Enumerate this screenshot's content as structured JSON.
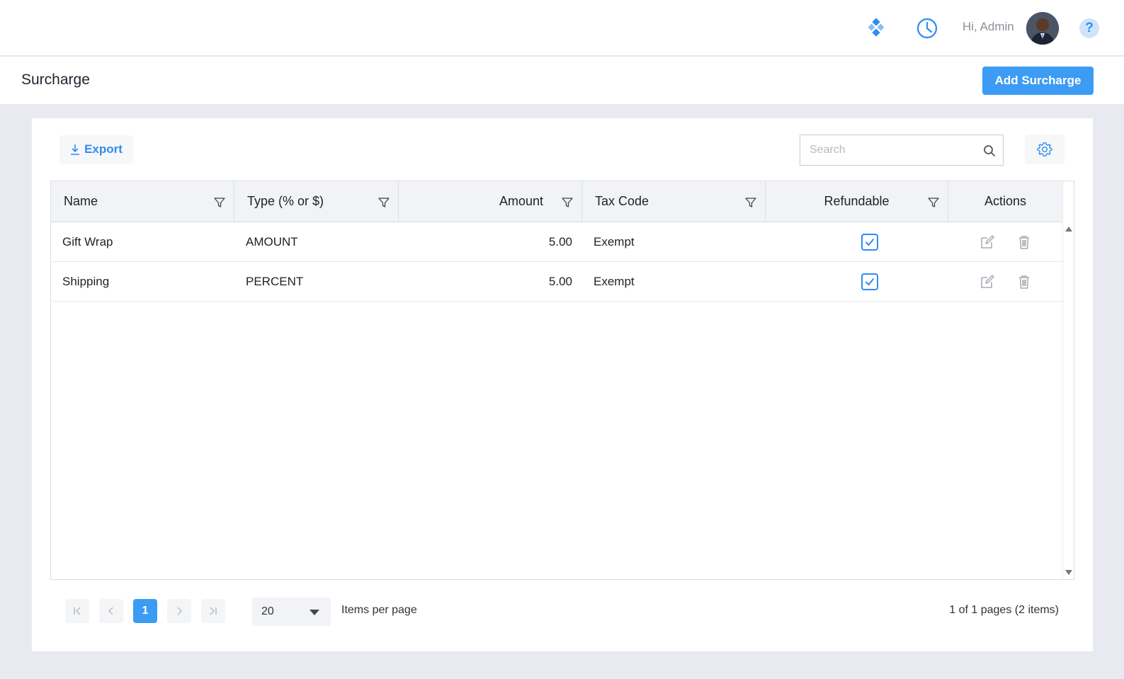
{
  "header": {
    "greeting": "Hi, Admin",
    "help_label": "?",
    "icons": [
      "widgets-icon",
      "clock-icon",
      "avatar",
      "help-icon"
    ],
    "accent_color": "#2f8cf0"
  },
  "page": {
    "title": "Surcharge",
    "add_button": "Add Surcharge"
  },
  "toolbar": {
    "export_label": "Export",
    "search_placeholder": "Search",
    "search_value": ""
  },
  "table": {
    "columns": [
      {
        "label": "Name"
      },
      {
        "label": "Type (% or $)"
      },
      {
        "label": "Amount"
      },
      {
        "label": "Tax Code"
      },
      {
        "label": "Refundable"
      },
      {
        "label": "Actions"
      }
    ],
    "rows": [
      {
        "name": "Gift Wrap",
        "type": "AMOUNT",
        "amount": "5.00",
        "tax_code": "Exempt",
        "refundable": true
      },
      {
        "name": "Shipping",
        "type": "PERCENT",
        "amount": "5.00",
        "tax_code": "Exempt",
        "refundable": true
      }
    ]
  },
  "pagination": {
    "current_page": "1",
    "page_size": "20",
    "items_per_page_label": "Items per page",
    "summary": "1 of 1 pages (2 items)"
  }
}
